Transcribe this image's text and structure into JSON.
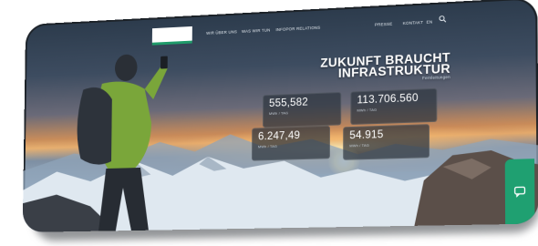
{
  "nav": {
    "logo_text": "",
    "items": [
      "WIR ÜBER UNS",
      "WAS WIR TUN",
      "INFOPOR RELATIONS"
    ],
    "right_items": [
      "PRESSE",
      "KONTAKT",
      "EN"
    ]
  },
  "hero": {
    "headline_line1": "ZUKUNFT BRAUCHT",
    "headline_line2": "INFRASTRUKTUR",
    "headline_sub": "Fernleitungen"
  },
  "stats": [
    {
      "value": "555,582",
      "label": "MWh / TAG",
      "sublabel": ""
    },
    {
      "value": "113.706.560",
      "label": "MWh / TAG",
      "sublabel": ""
    },
    {
      "value": "6.247,49",
      "label": "MWh / TAG",
      "sublabel": ""
    },
    {
      "value": "54.915",
      "label": "MWh / TAG",
      "sublabel": ""
    }
  ],
  "colors": {
    "accent_green": "#1fa071"
  },
  "icons": {
    "search": "search-icon",
    "green_tab": "chat-icon"
  }
}
